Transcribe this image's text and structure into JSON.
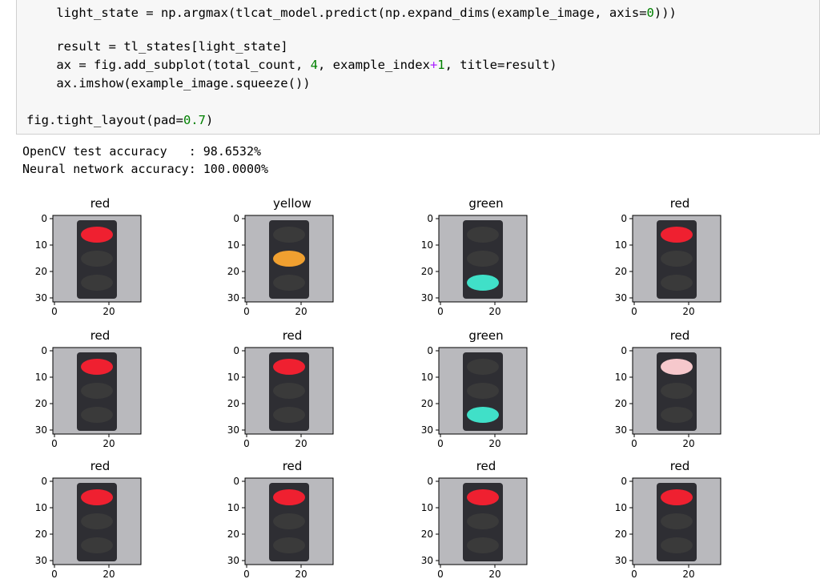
{
  "code": {
    "lines": [
      "light_state = np.argmax(tlcat_model.predict(np.expand_dims(example_image, axis=0)))",
      "",
      "result = tl_states[light_state]",
      "ax = fig.add_subplot(total_count, 4, example_index+1, title=result)",
      "ax.imshow(example_image.squeeze())",
      "",
      "fig.tight_layout(pad=0.7)"
    ]
  },
  "output": {
    "line1": "OpenCV test accuracy   : 98.6532%",
    "line2": "Neural network accuracy: 100.0000%"
  },
  "plots": [
    {
      "title": "red",
      "light": "red-top"
    },
    {
      "title": "yellow",
      "light": "yellow-mid"
    },
    {
      "title": "green",
      "light": "green-bottom"
    },
    {
      "title": "red",
      "light": "red-top"
    },
    {
      "title": "red",
      "light": "red-top"
    },
    {
      "title": "red",
      "light": "red-top"
    },
    {
      "title": "green",
      "light": "green-bottom"
    },
    {
      "title": "red",
      "light": "pale-top"
    },
    {
      "title": "red",
      "light": "red-top"
    },
    {
      "title": "red",
      "light": "red-top"
    },
    {
      "title": "red",
      "light": "red-top"
    },
    {
      "title": "red",
      "light": "red-top"
    }
  ],
  "axes": {
    "yticks": [
      "0",
      "10",
      "20",
      "30"
    ],
    "xticks": [
      "0",
      "20"
    ]
  }
}
